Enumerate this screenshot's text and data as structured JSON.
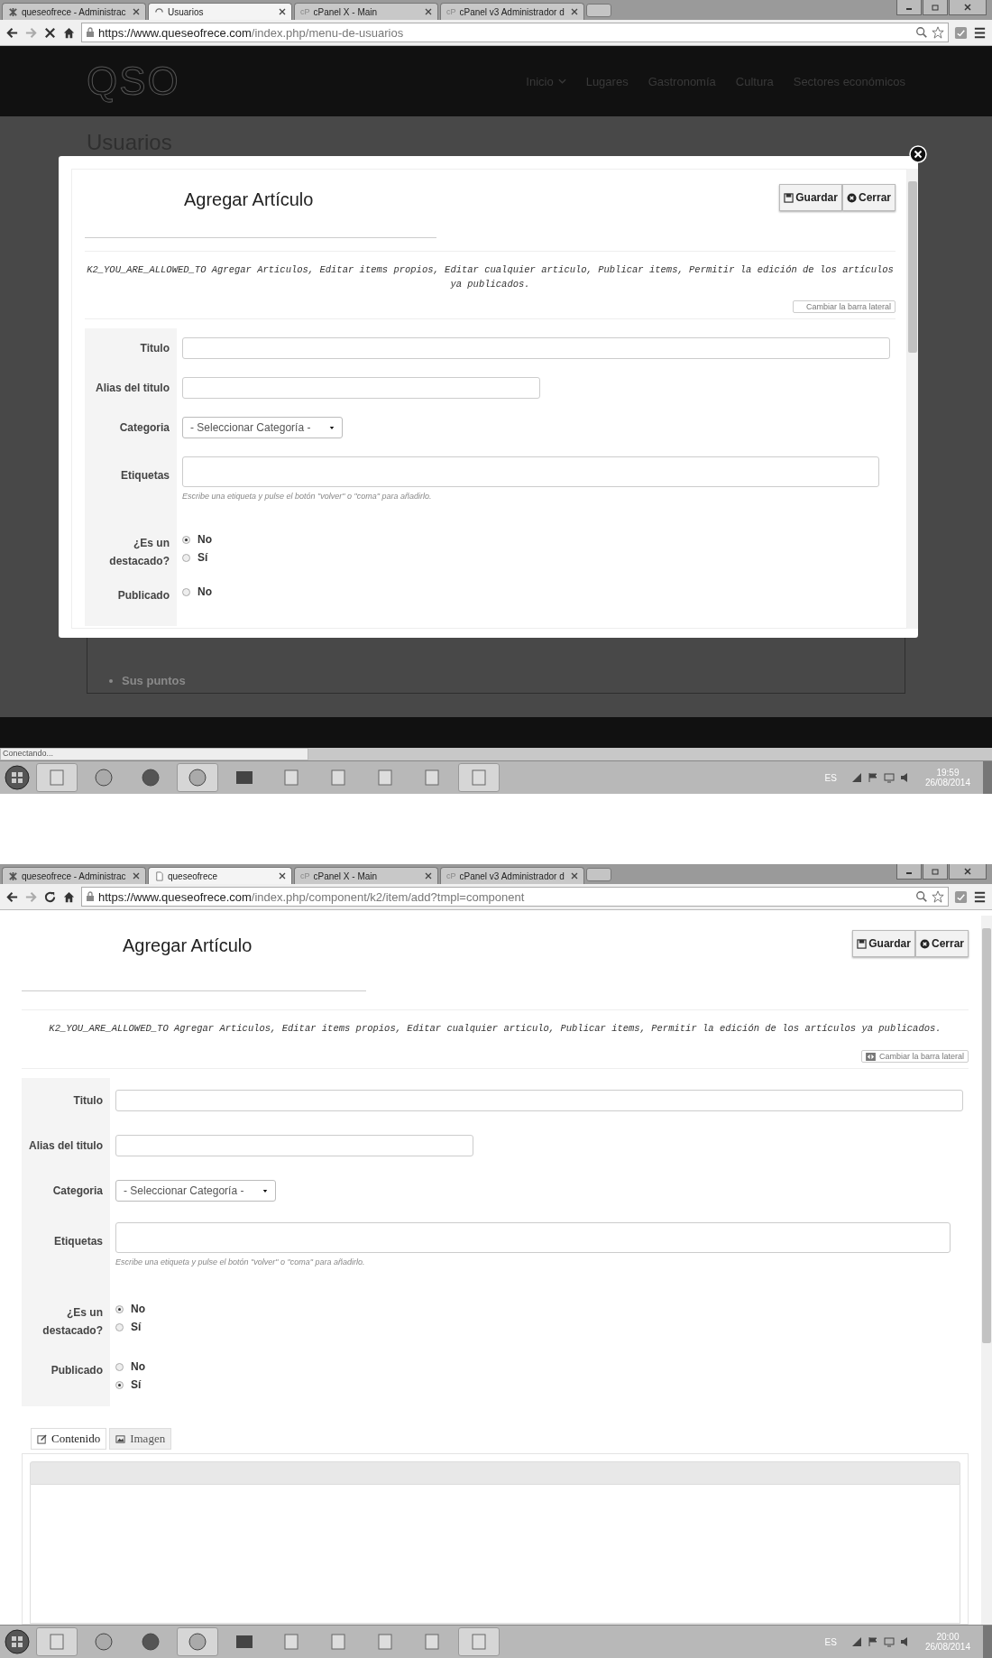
{
  "screenshots": [
    {
      "kind": "modal",
      "loading": true,
      "tabs": [
        {
          "label": "queseofrece - Administrac",
          "kind": "logo",
          "selected": false
        },
        {
          "label": "Usuarios",
          "kind": "spinner",
          "selected": true
        },
        {
          "label": "cPanel X - Main",
          "kind": "letters",
          "favicon_text": "cP",
          "selected": false
        },
        {
          "label": "cPanel v3 Administrador d",
          "kind": "letters",
          "favicon_text": "cP",
          "selected": false
        }
      ],
      "url": {
        "host": "https://www.queseofrece.com",
        "path": "/index.php/menu-de-usuarios"
      },
      "site": {
        "logo": "QSO",
        "nav": [
          {
            "label": "Inicio",
            "dropdown": true
          },
          {
            "label": "Lugares",
            "dropdown": false
          },
          {
            "label": "Gastronomía",
            "dropdown": false
          },
          {
            "label": "Cultura",
            "dropdown": false
          },
          {
            "label": "Sectores económicos",
            "dropdown": false
          }
        ],
        "page_title": "Usuarios",
        "list_item": "Sus puntos"
      },
      "status_text": "Conectando...",
      "form": {
        "title": "Agregar Artículo",
        "buttons": [
          {
            "kind": "save",
            "label": "Guardar"
          },
          {
            "kind": "close",
            "label": "Cerrar"
          }
        ],
        "permissions": "K2_YOU_ARE_ALLOWED_TO Agregar Articulos, Editar items propios, Editar cualquier articulo, Publicar items, Permitir la edición de los artículos ya publicados.",
        "sidebar_toggle": "Cambiar la barra lateral",
        "fields": [
          {
            "kind": "text",
            "label": "Titulo"
          },
          {
            "kind": "short-text",
            "label": "Alias del titulo"
          },
          {
            "kind": "select",
            "label": "Categoria",
            "value": "- Seleccionar Categoría -"
          },
          {
            "kind": "tags",
            "label": "Etiquetas",
            "help": "Escribe una etiqueta y pulse el botón \"volver\" o \"coma\" para añadirlo."
          },
          {
            "kind": "radio",
            "label": "¿Es un destacado?",
            "options": [
              {
                "label": "No",
                "selected": true
              },
              {
                "label": "Sí",
                "selected": false
              }
            ]
          },
          {
            "kind": "radio",
            "label": "Publicado",
            "options": [
              {
                "label": "No",
                "selected": false
              }
            ]
          }
        ]
      },
      "language": "ES",
      "clock": {
        "time": "19:59",
        "date": "26/08/2014"
      }
    },
    {
      "kind": "page",
      "loading": false,
      "tabs": [
        {
          "label": "queseofrece - Administrac",
          "kind": "logo",
          "selected": false
        },
        {
          "label": "queseofrece",
          "kind": "page",
          "selected": true
        },
        {
          "label": "cPanel X - Main",
          "kind": "letters",
          "favicon_text": "cP",
          "selected": false
        },
        {
          "label": "cPanel v3 Administrador d",
          "kind": "letters",
          "favicon_text": "cP",
          "selected": false
        }
      ],
      "url": {
        "host": "https://www.queseofrece.com",
        "path": "/index.php/component/k2/item/add?tmpl=component"
      },
      "form": {
        "title": "Agregar Artículo",
        "buttons": [
          {
            "kind": "save",
            "label": "Guardar"
          },
          {
            "kind": "close",
            "label": "Cerrar"
          }
        ],
        "permissions": "K2_YOU_ARE_ALLOWED_TO Agregar Articulos, Editar items propios, Editar cualquier articulo, Publicar items, Permitir la edición de los artículos ya publicados.",
        "sidebar_toggle": "Cambiar la barra lateral",
        "fields": [
          {
            "kind": "text",
            "label": "Titulo"
          },
          {
            "kind": "short-text",
            "label": "Alias del titulo"
          },
          {
            "kind": "select",
            "label": "Categoria",
            "value": "- Seleccionar Categoría -"
          },
          {
            "kind": "tags",
            "label": "Etiquetas",
            "help": "Escribe una etiqueta y pulse el botón \"volver\" o \"coma\" para añadirlo."
          },
          {
            "kind": "radio",
            "label": "¿Es un destacado?",
            "options": [
              {
                "label": "No",
                "selected": true
              },
              {
                "label": "Sí",
                "selected": false
              }
            ]
          },
          {
            "kind": "radio",
            "label": "Publicado",
            "options": [
              {
                "label": "No",
                "selected": false
              },
              {
                "label": "Sí",
                "selected": true
              }
            ]
          }
        ],
        "editor_tabs": [
          {
            "kind": "content",
            "label": "Contenido",
            "selected": true
          },
          {
            "kind": "image",
            "label": "Imagen",
            "selected": false
          }
        ]
      },
      "language": "ES",
      "clock": {
        "time": "20:00",
        "date": "26/08/2014"
      }
    }
  ]
}
